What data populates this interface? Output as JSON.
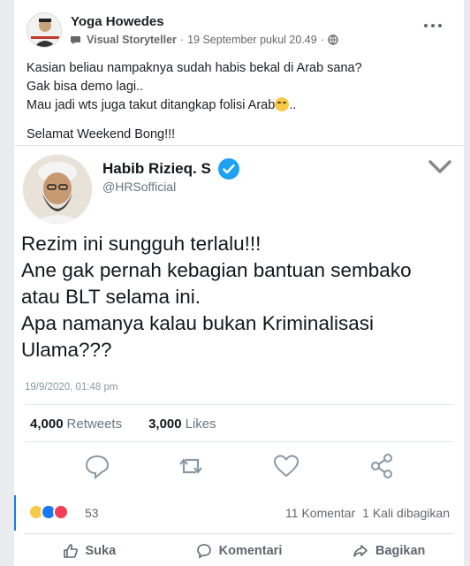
{
  "post": {
    "author": "Yoga Howedes",
    "role": "Visual Storyteller",
    "separator": "·",
    "timestamp": "19 September pukul 20.49",
    "separator2": "·",
    "lines": [
      "Kasian beliau nampaknya sudah habis bekal di Arab sana?",
      "Gak bisa demo lagi..",
      "Mau jadi wts juga takut ditangkap folisi Arab",
      "..",
      "Selamat Weekend Bong!!!"
    ]
  },
  "tweet": {
    "name": "Habib Rizieq. S",
    "handle": "@HRSofficial",
    "text_lines": [
      "Rezim ini sungguh terlalu!!!",
      "Ane gak pernah kebagian bantuan sembako",
      "atau BLT selama ini.",
      "Apa namanya kalau bukan Kriminalisasi",
      "Ulama???"
    ],
    "date": "19/9/2020, 01:48 pm",
    "retweets_count": "4,000",
    "retweets_label": "Retweets",
    "likes_count": "3,000",
    "likes_label": "Likes"
  },
  "reactions": {
    "count": "53",
    "comments": "11 Komentar",
    "shares": "1 Kali dibagikan"
  },
  "actions": {
    "like": "Suka",
    "comment": "Komentari",
    "share": "Bagikan"
  },
  "colors": {
    "facebook_blue": "#1877f2",
    "twitter_blue": "#1da1f2"
  }
}
